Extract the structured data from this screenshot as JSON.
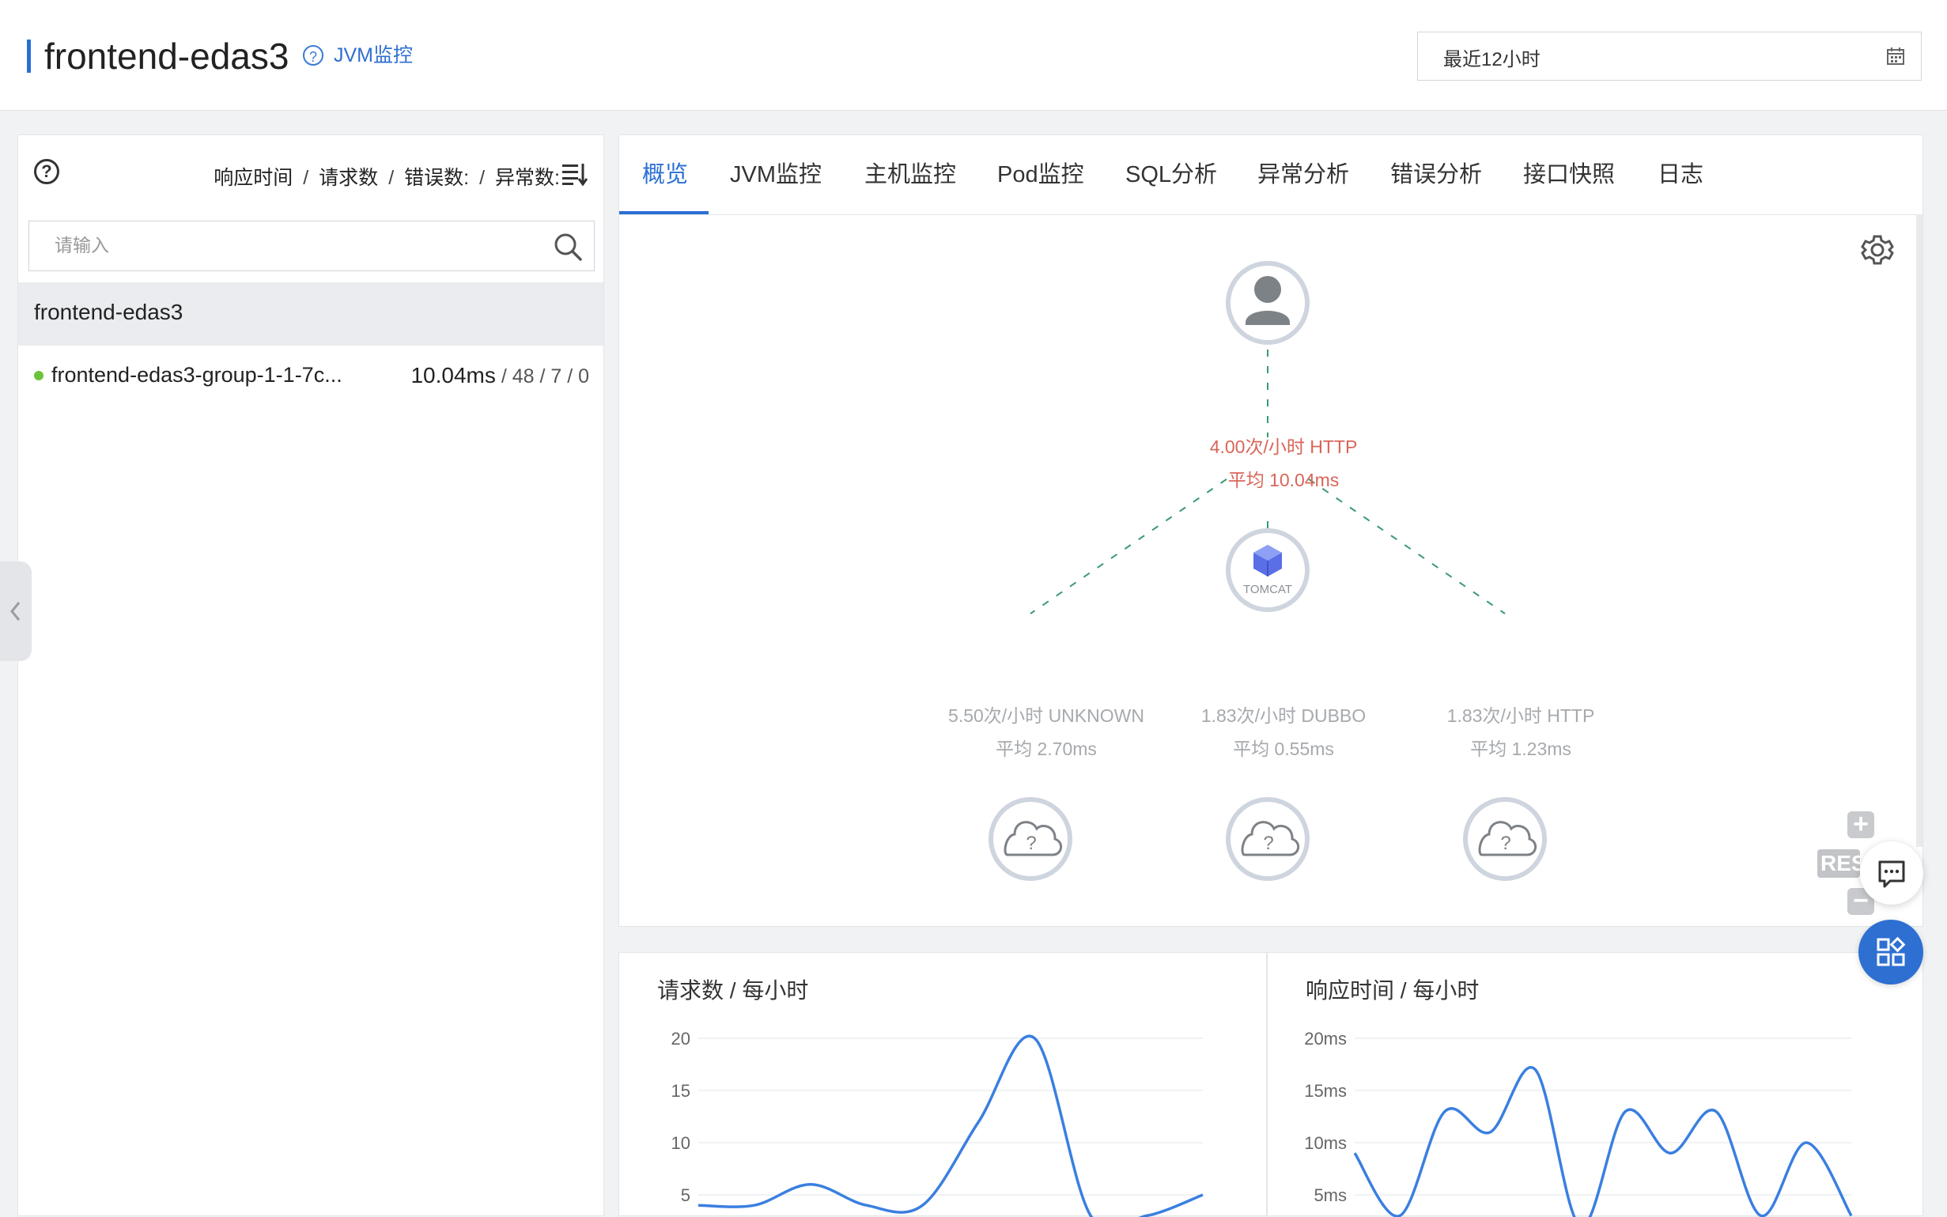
{
  "header": {
    "title": "frontend-edas3",
    "help_glyph": "?",
    "jvm_link": "JVM监控",
    "time_range": "最近12小时"
  },
  "left": {
    "help_glyph": "?",
    "metrics": {
      "response_time": "响应时间",
      "separator": "/",
      "requests": "请求数",
      "errors": "错误数:",
      "exceptions": "异常数:"
    },
    "search_placeholder": "请输入",
    "app_name": "frontend-edas3",
    "instance": {
      "name": "frontend-edas3-group-1-1-7c...",
      "response_time": "10.04ms",
      "counts": "/ 48 / 7 / 0",
      "status_color": "#6bc43b"
    }
  },
  "tabs": [
    {
      "label": "概览",
      "active": true
    },
    {
      "label": "JVM监控"
    },
    {
      "label": "主机监控"
    },
    {
      "label": "Pod监控"
    },
    {
      "label": "SQL分析"
    },
    {
      "label": "异常分析"
    },
    {
      "label": "错误分析"
    },
    {
      "label": "接口快照"
    },
    {
      "label": "日志"
    }
  ],
  "topology": {
    "tomcat_label": "TOMCAT",
    "unknown_glyph": "?",
    "inbound": {
      "line1": "4.00次/小时 HTTP",
      "line2": "平均 10.04ms"
    },
    "edges": [
      {
        "line1": "5.50次/小时 UNKNOWN",
        "line2": "平均 2.70ms"
      },
      {
        "line1": "1.83次/小时 DUBBO",
        "line2": "平均 0.55ms"
      },
      {
        "line1": "1.83次/小时 HTTP",
        "line2": "平均 1.23ms"
      }
    ],
    "zoom_in": "+",
    "zoom_out": "−",
    "reset": "RESET"
  },
  "chart_data": [
    {
      "type": "line",
      "title": "请求数 / 每小时",
      "y_ticks": [
        "20",
        "15",
        "10",
        "5"
      ],
      "ylim": [
        5,
        20
      ],
      "x": [
        0,
        1,
        2,
        3,
        4,
        5,
        6,
        7,
        8,
        9
      ],
      "values": [
        4,
        4,
        6,
        4,
        4,
        12,
        20,
        3,
        3,
        5
      ],
      "color": "#3a7fe0",
      "grid": true
    },
    {
      "type": "line",
      "title": "响应时间 / 每小时",
      "y_ticks": [
        "20ms",
        "15ms",
        "10ms",
        "5ms"
      ],
      "ylim": [
        5,
        20
      ],
      "x": [
        0,
        1,
        2,
        3,
        4,
        5,
        6,
        7,
        8,
        9,
        10,
        11
      ],
      "values": [
        9,
        3,
        13,
        11,
        17,
        2,
        13,
        9,
        13,
        3,
        10,
        3
      ],
      "color": "#3a7fe0",
      "grid": true
    }
  ],
  "colors": {
    "accent": "#2b6fd6",
    "edge": "#3a9a70",
    "inbound_text": "#d9655a",
    "edge_text": "#a6a9ad"
  }
}
